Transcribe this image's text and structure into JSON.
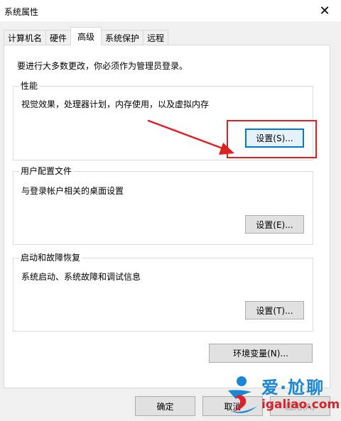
{
  "window": {
    "title": "系统属性",
    "close_glyph": "✕"
  },
  "tabs": [
    {
      "label": "计算机名",
      "active": false
    },
    {
      "label": "硬件",
      "active": false
    },
    {
      "label": "高级",
      "active": true
    },
    {
      "label": "系统保护",
      "active": false
    },
    {
      "label": "远程",
      "active": false
    }
  ],
  "notice": "要进行大多数更改，你必须作为管理员登录。",
  "performance": {
    "legend": "性能",
    "description": "视觉效果，处理器计划，内存使用，以及虚拟内存",
    "button": "设置(S)..."
  },
  "user_profiles": {
    "legend": "用户配置文件",
    "description": "与登录帐户相关的桌面设置",
    "button": "设置(E)..."
  },
  "startup_recovery": {
    "legend": "启动和故障恢复",
    "description": "系统启动、系统故障和调试信息",
    "button": "设置(T)..."
  },
  "env_button": "环境变量(N)...",
  "footer": {
    "ok": "确定",
    "cancel": "取消",
    "apply": "应用(A)"
  },
  "annotation": {
    "color": "#e02020"
  },
  "watermark": {
    "cn": "爱·尬聊",
    "en": "igaliao.com"
  },
  "colors": {
    "focus_border": "#0078d7",
    "button_bg": "#e1e1e1",
    "watermark_blue": "#1a86d6",
    "watermark_red": "#d8232a"
  }
}
